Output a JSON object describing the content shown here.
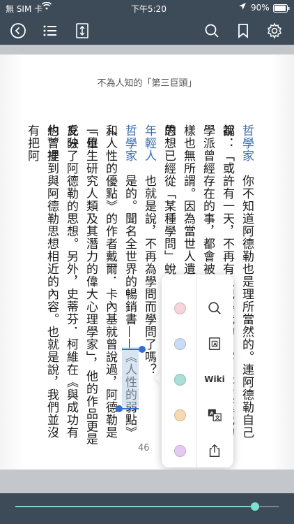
{
  "status_bar": {
    "carrier": "無 SIM 卡",
    "time": "下午5:20",
    "battery": "90%"
  },
  "toolbar": {
    "icons": [
      "back-icon",
      "table-of-contents-icon",
      "page-fit-icon",
      "search-icon",
      "bookmark-icon",
      "settings-icon"
    ]
  },
  "page": {
    "title": "不為人知的「第三巨頭」",
    "page_number": "46",
    "columns": [
      {
        "speaker": "哲學家",
        "text": "　你不知道阿德勒也是理所當然的。連阿德勒自己都"
      },
      {
        "speaker": "",
        "text": "說：「或許有一天，不再有人記得我的名字，甚至連我的學"
      },
      {
        "speaker": "",
        "text": "學派曾經存在的事，都會被忘得一乾二淨吧。」但他也說，"
      },
      {
        "speaker": "",
        "text": "樣也無所謂。因為當世人遺忘阿德勒的名字時，就表示他的"
      },
      {
        "speaker": "",
        "text": "思想已經從「某種學問」蛻變為人們的「常識」了。"
      },
      {
        "speaker": "年輕人",
        "text": "　也就是說，不再為學問而學問了嗎？"
      },
      {
        "speaker": "哲學家",
        "text": "　是的。聞名全世界的暢銷書——《人性的弱點》和"
      },
      {
        "speaker": "",
        "text": "《人性的優點》的作者戴爾．卡內基就曾說過，阿德勒是一位"
      },
      {
        "speaker": "",
        "text": "「畢生研究人類及其潛力的偉大心理學家」，他的作品更是充分"
      },
      {
        "speaker": "",
        "text": "反映了阿德勒的思想。另外，史蒂芬．柯維在《與成功有約》裡"
      },
      {
        "speaker": "",
        "text": "也曾提到與阿德勒思想相近的內容。也就是說，我們並沒有把阿"
      }
    ],
    "highlighted_text": "人性的弱點"
  },
  "popup": {
    "colors": [
      "#f7d3dc",
      "#c9dcf7",
      "#a8e0d8",
      "#f7d9b0",
      "#e6c9f2"
    ],
    "tools": [
      "search-icon",
      "dictionary-icon",
      "Wiki",
      "translate-icon",
      "share-icon"
    ],
    "wiki_label": "Wiki"
  },
  "slider": {
    "progress": 0.91
  }
}
